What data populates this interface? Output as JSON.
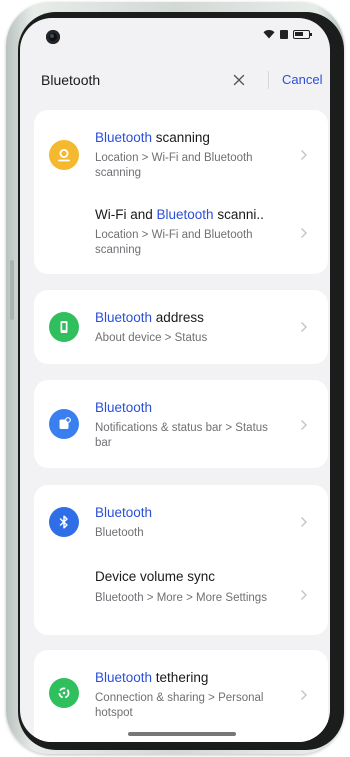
{
  "search": {
    "query": "Bluetooth",
    "cancel_label": "Cancel"
  },
  "results": [
    {
      "title_highlight": "Bluetooth",
      "title_rest": " scanning",
      "subtitle": "Location > Wi-Fi and Bluetooth scanning",
      "icon": "location-icon",
      "icon_color": "#f4b92f"
    },
    {
      "title_prefix": "Wi-Fi and ",
      "title_highlight": "Bluetooth",
      "title_rest": " scanni..",
      "subtitle": "Location > Wi-Fi and Bluetooth scanning"
    },
    {
      "title_highlight": "Bluetooth",
      "title_rest": " address",
      "subtitle": "About device > Status",
      "icon": "phone-icon",
      "icon_color": "#2fbf5c"
    },
    {
      "title_highlight": "Bluetooth",
      "title_rest": "",
      "subtitle": "Notifications & status bar > Status bar",
      "icon": "notification-icon",
      "icon_color": "#3a7ff0"
    },
    {
      "title_highlight": "Bluetooth",
      "title_rest": "",
      "subtitle": "Bluetooth",
      "icon": "bluetooth-icon",
      "icon_color": "#2f6ee6"
    },
    {
      "title_prefix": "Device volume sync",
      "title_highlight": "",
      "title_rest": "",
      "subtitle": "Bluetooth > More > More Settings"
    },
    {
      "title_highlight": "Bluetooth",
      "title_rest": " tethering",
      "subtitle": "Connection & sharing > Personal hotspot",
      "icon": "hotspot-icon",
      "icon_color": "#2fbf5c"
    }
  ],
  "colors": {
    "accent": "#2b4fd8",
    "background": "#f2f2f4"
  }
}
